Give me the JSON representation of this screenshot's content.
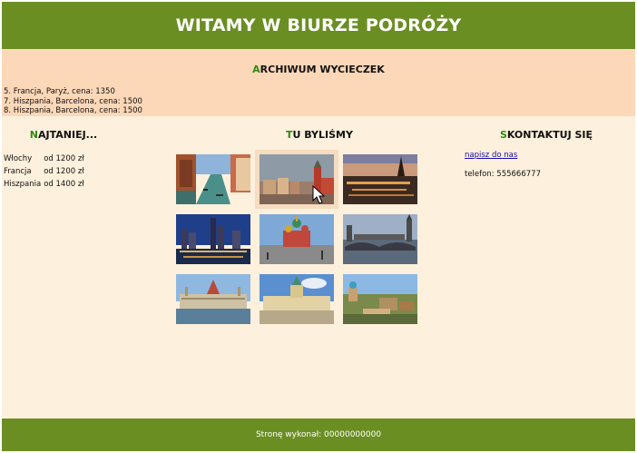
{
  "banner": {
    "title": "WITAMY W BIURZE PODRÓŻY"
  },
  "archive": {
    "title_first": "A",
    "title_rest": "RCHIWUM WYCIECZEK",
    "items": [
      "5. Francja, Paryż, cena: 1350",
      "7. Hiszpania, Barcelona, cena: 1500",
      "8. Hiszpania, Barcelona, cena: 1500"
    ]
  },
  "cheapest": {
    "title_first": "N",
    "title_rest": "AJTANIEJ...",
    "rows": [
      {
        "country": "Włochy",
        "price": "od 1200 zł"
      },
      {
        "country": "Francja",
        "price": "od 1200 zł"
      },
      {
        "country": "Hiszpania",
        "price": "od 1400 zł"
      }
    ]
  },
  "gallery": {
    "title_first": "T",
    "title_rest": "U BYLIŚMY",
    "photos": [
      "venice-canal",
      "warsaw-old-town",
      "paris-evening",
      "city-skyline-night",
      "moscow-cathedral",
      "london-bridge",
      "budapest-parliament",
      "berlin-palace",
      "barcelona-park-guell"
    ]
  },
  "contact": {
    "title_first": "S",
    "title_rest": "KONTAKTUJ SIĘ",
    "link_text": "napisz do nas",
    "phone": "telefon: 555666777"
  },
  "footer": {
    "text": "Stronę wykonał: 00000000000"
  },
  "colors": {
    "header_green": "#6b8e23",
    "accent_green": "#2e8b12",
    "archive_bg": "#fdd8b8",
    "page_bg": "#fdf0dc",
    "link_blue": "#1a0dab"
  }
}
